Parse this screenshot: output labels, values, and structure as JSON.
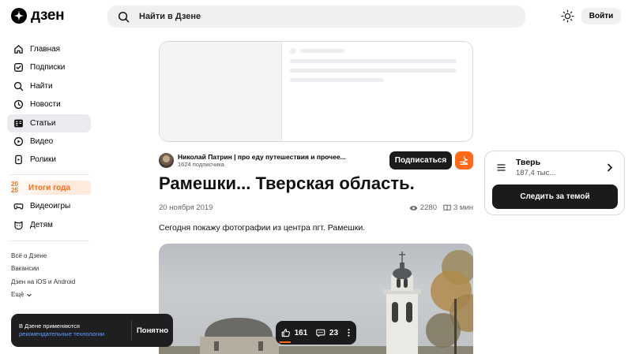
{
  "header": {
    "logo_text": "дзен",
    "search_placeholder": "Найти в Дзене",
    "login_label": "Войти"
  },
  "sidebar": {
    "items": [
      {
        "label": "Главная",
        "icon": "home-icon"
      },
      {
        "label": "Подписки",
        "icon": "subscriptions-icon"
      },
      {
        "label": "Найти",
        "icon": "search-icon"
      },
      {
        "label": "Новости",
        "icon": "news-icon"
      },
      {
        "label": "Статьи",
        "icon": "articles-icon",
        "active": true
      },
      {
        "label": "Видео",
        "icon": "video-icon"
      },
      {
        "label": "Ролики",
        "icon": "shorts-icon"
      }
    ],
    "year_badge_top": "20",
    "year_badge_bottom": "25",
    "year_label": "Итоги года",
    "extra_items": [
      {
        "label": "Видеоигры",
        "icon": "gamepad-icon"
      },
      {
        "label": "Детям",
        "icon": "kids-icon"
      }
    ],
    "footer_links": [
      "Всё о Дзене",
      "Вакансии",
      "Дзен на iOS и Android",
      "Ещё"
    ]
  },
  "article": {
    "author_name": "Николай Патрин | про еду путешествия и прочее...",
    "author_subscribers": "1624 подписчика",
    "subscribe_label": "Подписаться",
    "title": "Рамешки... Тверская область.",
    "date": "20 ноября 2019",
    "views": "2280",
    "read_time": "3 мин",
    "lead": "Сегодня покажу фотографии из центра пгт. Рамешки."
  },
  "reactions": {
    "likes": "161",
    "comments": "23"
  },
  "cookie": {
    "text": "В Дзене применяются",
    "link": "рекомендательные технологии",
    "ok_label": "Понятно"
  },
  "topic": {
    "name": "Тверь",
    "count": "187,4 тыс...",
    "follow_label": "Следить за темой"
  },
  "colors": {
    "accent": "#ff6a1a",
    "dark_button": "#1b1b1d",
    "link": "#5aa0ff"
  }
}
